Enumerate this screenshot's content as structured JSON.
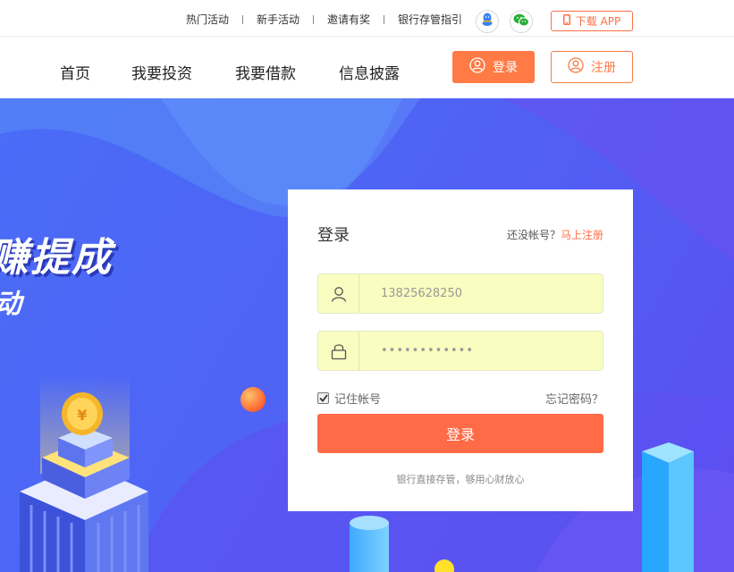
{
  "topbar": {
    "links": [
      "热门活动",
      "新手活动",
      "邀请有奖",
      "银行存管指引"
    ],
    "qq_icon": "qq-icon",
    "wechat_icon": "wechat-icon",
    "app_label": "下载 APP"
  },
  "nav": {
    "items": [
      "首页",
      "我要投资",
      "我要借款",
      "信息披露"
    ],
    "login_label": "登录",
    "register_label": "注册"
  },
  "hero": {
    "slogan": "赚提成",
    "slogan2": "动"
  },
  "login": {
    "title": "登录",
    "no_account": "还没帐号？",
    "register_link": "马上注册",
    "username_value": "13825628250",
    "password_value": "••••••••••••",
    "remember_label": "记住帐号",
    "remember_checked": true,
    "forgot_label": "忘记密码？",
    "submit_label": "登录",
    "footer": "银行直接存管，够用心财放心"
  },
  "colors": {
    "accent": "#ff6e46",
    "hero_bg": "#4f63f5"
  }
}
